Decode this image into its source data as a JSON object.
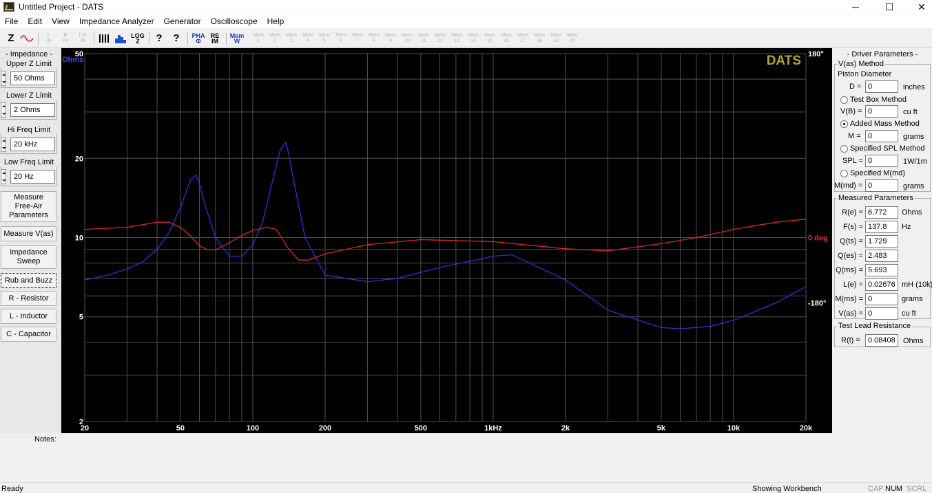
{
  "window": {
    "title": "Untitled Project - DATS",
    "minimize_glyph": "─",
    "maximize_glyph": "☐",
    "close_glyph": "✕"
  },
  "menu": [
    "File",
    "Edit",
    "View",
    "Impedance Analyzer",
    "Generator",
    "Oscilloscope",
    "Help"
  ],
  "toolbar": {
    "z": "Z",
    "l_in": "L\nIN",
    "r_in": "R\nIN",
    "lr_in": "L R\nIN",
    "log": "LOG\nZ",
    "help": "?",
    "help_ctx": "?",
    "pha": "PHA\nΦ",
    "reim": "RE\nIM",
    "memw": "Mem\nW",
    "mems": [
      "Mem\n1",
      "Mem\n2",
      "Mem\n3",
      "Mem\n4",
      "Mem\n5",
      "Mem\n6",
      "Mem\n7",
      "Mem\n8",
      "Mem\n9",
      "Mem\n10",
      "Mem\n11",
      "Mem\n12",
      "Mem\n13",
      "Mem\n14",
      "Mem\n15",
      "Mem\n16",
      "Mem\n17",
      "Mem\n18",
      "Mem\n19",
      "Mem\n20"
    ]
  },
  "left": {
    "impedance_title": "- Impedance -",
    "upper_label": "Upper Z Limit",
    "upper_value": "50 Ohms",
    "lower_label": "Lower Z Limit",
    "lower_value": "2 Ohms",
    "hi_label": "Hi Freq Limit",
    "hi_value": "20 kHz",
    "low_label": "Low Freq Limit",
    "low_value": "20 Hz",
    "buttons": [
      "Measure\nFree-Air\nParameters",
      "Measure V(as)",
      "Impedance\nSweep",
      "Rub and Buzz",
      "R - Resistor",
      "L - Inductor",
      "C - Capacitor"
    ]
  },
  "right": {
    "title": "- Driver Parameters -",
    "vas_method": "V(as) Method",
    "piston": "Piston Diameter",
    "d_label": "D =",
    "d_value": "0",
    "d_unit": "inches",
    "test_box": "Test Box Method",
    "vb_label": "V(B) =",
    "vb_value": "0",
    "vb_unit": "cu ft",
    "added_mass": "Added Mass Method",
    "m_label": "M =",
    "m_value": "0",
    "m_unit": "grams",
    "spl_method": "Specified SPL Method",
    "spl_label": "SPL =",
    "spl_value": "0",
    "spl_unit": "1W/1m",
    "mmd_method": "Specified M(md)",
    "mmd_label": "M(md) =",
    "mmd_value": "0",
    "mmd_unit": "grams",
    "measured_title": "Measured Parameters",
    "measured": [
      {
        "label": "R(e) =",
        "value": "6.772",
        "unit": "Ohms"
      },
      {
        "label": "F(s) =",
        "value": "137.8",
        "unit": "Hz"
      },
      {
        "label": "Q(ts) =",
        "value": "1.729",
        "unit": ""
      },
      {
        "label": "Q(es) =",
        "value": "2.483",
        "unit": ""
      },
      {
        "label": "Q(ms) =",
        "value": "5.693",
        "unit": ""
      },
      {
        "label": "L(e) =",
        "value": "0.02676",
        "unit": "mH (10k)"
      },
      {
        "label": "M(ms) =",
        "value": "0",
        "unit": "grams"
      },
      {
        "label": "V(as) =",
        "value": "0",
        "unit": "cu ft"
      }
    ],
    "lead_title": "Test Lead Resistance",
    "rt_label": "R(t) =",
    "rt_value": "0.08408",
    "rt_unit": "Ohms"
  },
  "notes_label": "Notes:",
  "status": {
    "left": "Ready",
    "mid": "Showing Workbench",
    "cap": "CAP",
    "num": "NUM",
    "scrl": "SCRL"
  },
  "chart_data": {
    "type": "line",
    "watermark": "DATS",
    "xscale": "log",
    "xlim": [
      20,
      20000
    ],
    "x_ticks": [
      20,
      50,
      100,
      200,
      500,
      1000,
      2000,
      5000,
      10000,
      20000
    ],
    "x_tick_labels": [
      "20",
      "50",
      "100",
      "200",
      "500",
      "1kHz",
      "2k",
      "5k",
      "10k",
      "20k"
    ],
    "yscale": "log",
    "ylim": [
      2,
      50
    ],
    "y_ticks": [
      2,
      5,
      10,
      20,
      50
    ],
    "y_tick_labels": [
      "2",
      "5",
      "10",
      "20",
      "50"
    ],
    "ylabel": "Ohms",
    "y2lim": [
      -180,
      180
    ],
    "y2_tick_labels": [
      "180°",
      "0 deg",
      "-180°"
    ],
    "grid": true,
    "colors": {
      "impedance": "#3030d8",
      "phase": "#d82828",
      "grid": "#505050",
      "watermark": "#b3a62e",
      "ohms_label": "#4545e0",
      "deg_label": "#e03030"
    },
    "series": [
      {
        "key": "impedance",
        "axis": "left",
        "x": [
          20,
          25,
          30,
          35,
          40,
          45,
          50,
          55,
          58,
          60,
          63,
          70,
          80,
          90,
          100,
          110,
          120,
          130,
          137,
          140,
          150,
          165,
          200,
          300,
          400,
          600,
          900,
          1000,
          1200,
          1300,
          2000,
          3000,
          5000,
          6000,
          8000,
          10000,
          15000,
          20000
        ],
        "y": [
          6.9,
          7.2,
          7.6,
          8.1,
          9.0,
          10.5,
          13.0,
          16.5,
          17.3,
          16.0,
          13.5,
          10.0,
          8.5,
          8.5,
          9.4,
          11.5,
          16.0,
          21.5,
          23.0,
          21.5,
          15.5,
          10.0,
          7.2,
          6.8,
          7.0,
          7.7,
          8.3,
          8.5,
          8.6,
          8.3,
          6.9,
          5.3,
          4.55,
          4.5,
          4.6,
          4.85,
          5.65,
          6.5
        ]
      },
      {
        "key": "phase",
        "axis": "right",
        "x": [
          20,
          30,
          40,
          45,
          50,
          55,
          60,
          65,
          70,
          80,
          90,
          100,
          115,
          125,
          130,
          140,
          155,
          170,
          200,
          300,
          500,
          1000,
          2000,
          3000,
          5000,
          7000,
          10000,
          15000,
          20000
        ],
        "y": [
          8,
          10,
          15,
          15,
          10,
          2,
          -8,
          -12,
          -12,
          -5,
          2,
          7,
          10,
          8,
          2,
          -10,
          -22,
          -22,
          -16,
          -7,
          -2,
          -4,
          -11,
          -13,
          -6,
          0,
          8,
          15,
          18
        ]
      }
    ]
  }
}
